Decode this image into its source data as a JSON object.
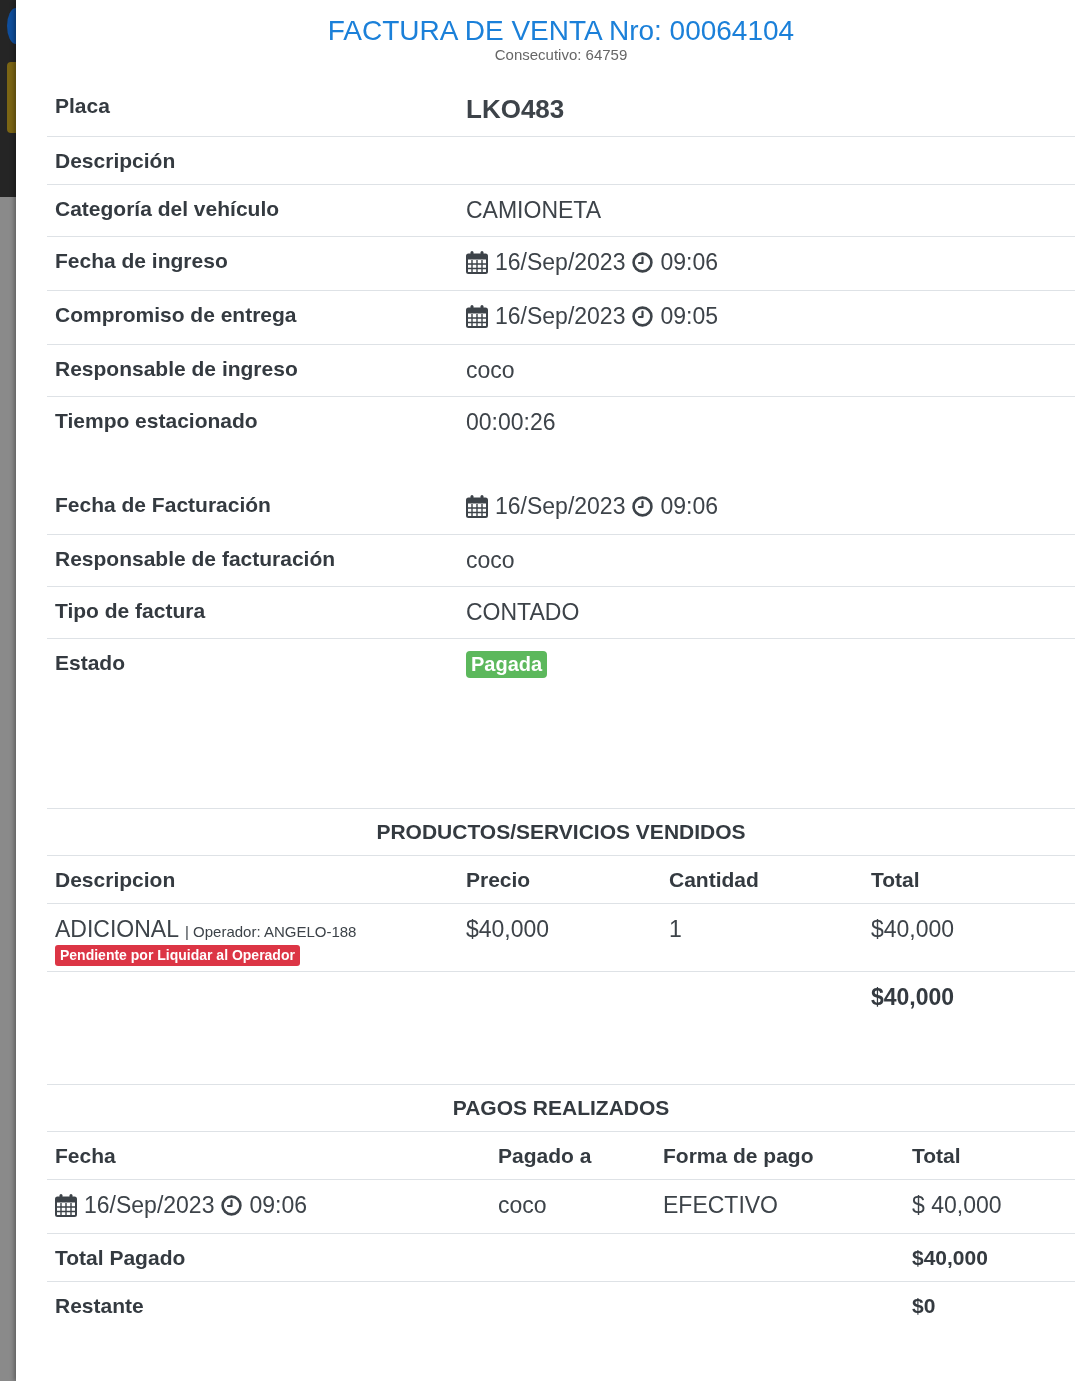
{
  "invoice": {
    "title": "FACTURA DE VENTA Nro: 00064104",
    "consecutive": "Consecutivo: 64759"
  },
  "vehicle_info": [
    {
      "label": "Placa",
      "kind": "plate",
      "value": "LKO483"
    },
    {
      "label": "Descripción",
      "kind": "text"
    },
    {
      "label": "Categoría del vehículo",
      "kind": "text",
      "value": "CAMIONETA"
    },
    {
      "label": "Fecha de ingreso",
      "kind": "datetime",
      "date": "16/Sep/2023",
      "time": "09:06"
    },
    {
      "label": "Compromiso de entrega",
      "kind": "datetime",
      "date": "16/Sep/2023",
      "time": "09:05"
    },
    {
      "label": "Responsable de ingreso",
      "kind": "text",
      "value": "coco"
    },
    {
      "label": "Tiempo estacionado",
      "kind": "text",
      "value": "00:00:26"
    }
  ],
  "billing_info": [
    {
      "label": "Fecha de Facturación",
      "kind": "datetime",
      "date": "16/Sep/2023",
      "time": "09:06"
    },
    {
      "label": "Responsable de facturación",
      "kind": "text",
      "value": "coco"
    },
    {
      "label": "Tipo de factura",
      "kind": "text",
      "value": "CONTADO"
    },
    {
      "label": "Estado",
      "kind": "status",
      "value": "Pagada"
    }
  ],
  "products": {
    "title": "PRODUCTOS/SERVICIOS VENDIDOS",
    "columns": [
      "Descripcion",
      "Precio",
      "Cantidad",
      "Total"
    ],
    "rows": [
      {
        "name": "ADICIONAL",
        "operator": "| Operador: ANGELO-188",
        "badge": "Pendiente por Liquidar al Operador",
        "price": "$40,000",
        "quantity": "1",
        "total": "$40,000"
      }
    ],
    "grand_total": "$40,000"
  },
  "payments": {
    "title": "PAGOS REALIZADOS",
    "columns": [
      "Fecha",
      "Pagado a",
      "Forma de pago",
      "Total"
    ],
    "rows": [
      {
        "date": "16/Sep/2023",
        "time": "09:06",
        "paid_to": "coco",
        "method": "EFECTIVO",
        "total": "$ 40,000"
      }
    ],
    "summary": [
      {
        "label": "Total Pagado",
        "value": "$40,000"
      },
      {
        "label": "Restante",
        "value": "$0"
      }
    ]
  }
}
